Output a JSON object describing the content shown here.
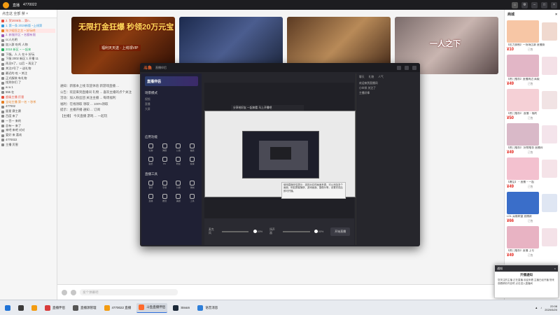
{
  "topbar": {
    "title": "直播",
    "room": "4770022",
    "home_icon": "home-icon"
  },
  "left_panel": {
    "header": "点击这 全部 禁 ×",
    "items": [
      {
        "text": "2. 贺2006年... 第n..",
        "color": "#e74c3c"
      },
      {
        "text": "1. 第一条 2019新版 ~上线第",
        "color": "#3498db"
      },
      {
        "text": "年少轻狂之主 ~ 好玩吧",
        "color": "#e67e22"
      },
      {
        "text": "2. 新服开区 ~ 名额有限",
        "color": "#9b59b6"
      },
      {
        "text": "cc人光明",
        "color": "#888"
      },
      {
        "text": "加入群 吃鸡 人物",
        "color": "#888"
      },
      {
        "text": "2018 新区 ~ 一起来",
        "color": "#27ae60"
      },
      {
        "text": "下服。人 人 在十 好玩",
        "color": "#888"
      },
      {
        "text": "下服 2002 新区 1 开播 11",
        "color": "#888"
      },
      {
        "text": "再见9了，以后 ~ 再见了",
        "color": "#888"
      },
      {
        "text": "关注2号了 ~ 送礼物",
        "color": "#888"
      },
      {
        "text": "最近的 吃 ~ 关注",
        "color": "#888"
      },
      {
        "text": "正式服装 有礼物",
        "color": "#888"
      },
      {
        "text": "找到你们 了",
        "color": "#888"
      },
      {
        "text": "w w 1",
        "color": "#888"
      },
      {
        "text": "555 在",
        "color": "#888"
      },
      {
        "text": "超级主播 厉害",
        "color": "#e74c3c"
      },
      {
        "text": "全站主播 第一名 ~ 秒杀",
        "color": "#e67e22"
      },
      {
        "text": "477002",
        "color": "#888"
      },
      {
        "text": "星星 赛主赛",
        "color": "#888"
      },
      {
        "text": "百度 来了",
        "color": "#888"
      },
      {
        "text": "一百一 来的",
        "color": "#888"
      },
      {
        "text": "总有一 来了",
        "color": "#888"
      },
      {
        "text": "来吧 来吧 对对",
        "color": "#888"
      },
      {
        "text": "爱好 来 喜欢",
        "color": "#888"
      },
      {
        "text": "4770022",
        "color": "#888"
      },
      {
        "text": "主播 厉害",
        "color": "#888"
      }
    ]
  },
  "banners": [
    {
      "text": "无限打金狂爆 秒领20万元宝",
      "sub": "福利天天送 · 上线领VIP"
    },
    {
      "text": "",
      "sub": ""
    },
    {
      "text": "",
      "sub": ""
    },
    {
      "text": "一人之下",
      "sub": ""
    }
  ],
  "info_lines": [
    "通知：新版本上线 欢迎体验 新游戏直播 ...",
    "公告：欢迎来到直播间 礼物 ... 喜欢主播的点个关注",
    "活动：加入粉丝团 关注主播 ... 每周福利",
    "福利：在线领取 领取 ... 100%领取",
    "提示：主播开播 通知 ... 订阅",
    "【主播】 今天直播 游戏 ... 一起玩"
  ],
  "bottom_bar": {
    "placeholder": "发个弹幕吧"
  },
  "right_panel": {
    "title": "商城",
    "close": "×",
    "cards": [
      {
        "tag": "【拉力赛制】一场场比赛 直播赛",
        "price": "¥10",
        "count": "已售",
        "thumb": "#f7c6a5",
        "side": "#f0d9cf"
      },
      {
        "tag": "【热门推荐】直播周边 高级",
        "price": "¥49",
        "count": "已售",
        "thumb": "#e2b6c6",
        "side": "#f4e1e7"
      },
      {
        "tag": "【热门推荐】 直播 ~ 福利",
        "price": "¥50",
        "count": "已售",
        "thumb": "#f5d0d6",
        "side": "#f1e3e4"
      },
      {
        "tag": "【热门推荐】 好物推荐 直播间",
        "price": "¥49",
        "count": "已售",
        "thumb": "#d9b9c8",
        "side": "#f4e4eb"
      },
      {
        "tag": "【赠品】 ~ 直播 ~ 一起",
        "price": "¥49",
        "count": "已售",
        "thumb": "#f3c1cf",
        "side": "#f5e3e8"
      },
      {
        "tag": "LOL 英雄联盟 直播赛",
        "price": "¥66",
        "count": "已售",
        "thumb": "#3a6ec9",
        "side": "#dfe6f3"
      },
      {
        "tag": "【热门推荐】直播 上号",
        "price": "¥49",
        "count": "已售",
        "thumb": "#e8b3c3",
        "side": "#f4e2e8"
      }
    ]
  },
  "win1": {
    "logo": "斗鱼",
    "tab_label": "直播伴侣",
    "left_brand": "直播伴侣",
    "section_scene": "场景模式",
    "sub_items": [
      "视频",
      "直播",
      "大屏"
    ],
    "grid_title_1": "应用功能",
    "grid_title_2": "直播工具",
    "grid_labels": [
      "礼物",
      "弹幕",
      "公告",
      "抽奖",
      "贴纸",
      "PK",
      "粉丝",
      "投票",
      "音乐",
      "字幕",
      "分屏",
      "录制",
      "直播",
      "推流",
      "美颜",
      "工具"
    ],
    "preview_tip": "分享给好友 一起来看 马上开播吧",
    "tooltip": "使用直播伴侣提示：选择对应的画面来源，可以添加多个画面，例如屏幕捕获、游戏画面、摄像头等，设置完成后即可开播。",
    "right_tabs": [
      "聊天",
      "礼物",
      "人气"
    ],
    "right_msgs": [
      "欢迎来到直播间",
      "小伙伴 关注了",
      "主播好棒"
    ],
    "live_button": "开始直播",
    "mic_label": "麦克风",
    "sound_label": "扬声器",
    "vol1": "100%",
    "vol2": "100%"
  },
  "notify": {
    "header": "通知",
    "title": "开播通知",
    "body": "您关注的主播 正在直播 欢迎来看 主播已经开播 快来观看精彩内容吧 点击进入直播间"
  },
  "taskbar": {
    "apps": [
      {
        "label": "",
        "color": "#1f72d6"
      },
      {
        "label": "",
        "color": "#3b3b3b"
      },
      {
        "label": "",
        "color": "#f39c12"
      },
      {
        "label": "直播伴侣",
        "color": "#d83b3b"
      },
      {
        "label": "直播源管理",
        "color": "#555"
      },
      {
        "label": "4770022 直播",
        "color": "#f39c12"
      },
      {
        "label": "斗鱼直播伴侣",
        "color": "#ff6a2c"
      },
      {
        "label": "Steam",
        "color": "#1b2838"
      },
      {
        "label": "语音消息",
        "color": "#2e7fd9"
      }
    ],
    "time": "22:08",
    "date": "2020/5/20"
  }
}
